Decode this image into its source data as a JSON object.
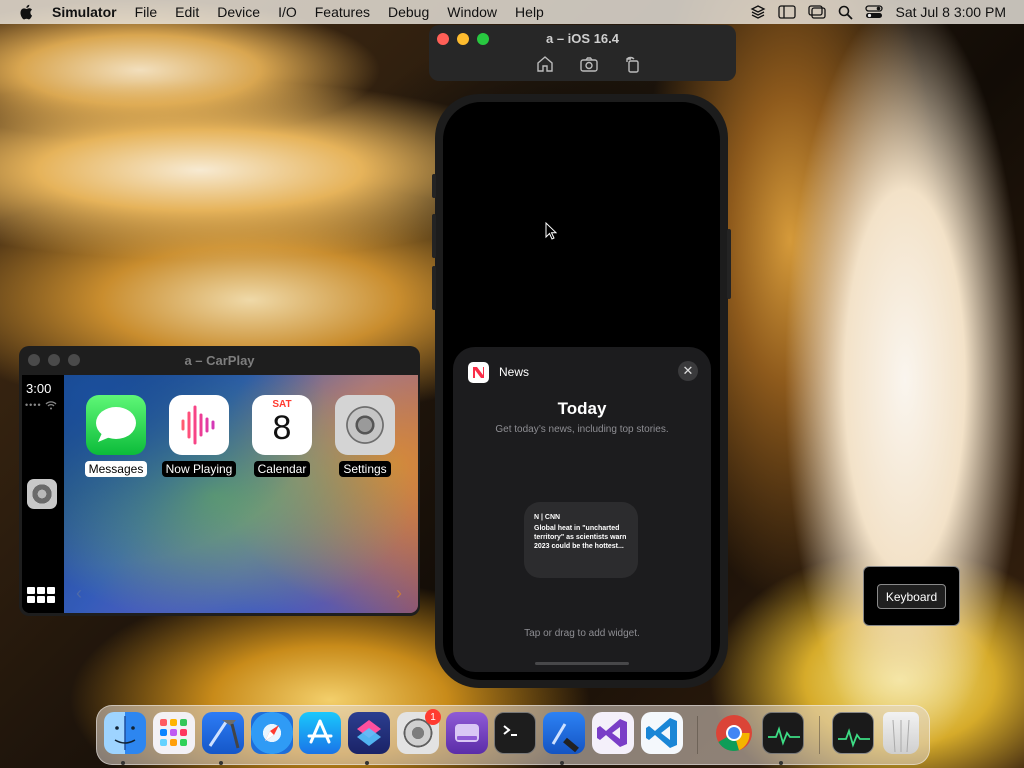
{
  "menubar": {
    "app_name": "Simulator",
    "items": [
      "File",
      "Edit",
      "Device",
      "I/O",
      "Features",
      "Debug",
      "Window",
      "Help"
    ],
    "clock": "Sat Jul 8  3:00 PM"
  },
  "simulator": {
    "title": "a – iOS 16.4"
  },
  "news_sheet": {
    "app_name": "News",
    "close_glyph": "✕",
    "title": "Today",
    "subtitle": "Get today’s news, including top stories.",
    "widget": {
      "source": "N | CNN",
      "headline": "Global heat in \"uncharted territory\" as scientists warn 2023 could be the hottest..."
    },
    "hint": "Tap or drag to add widget."
  },
  "carplay": {
    "title": "a – CarPlay",
    "time": "3:00",
    "apps": [
      {
        "label": "Messages",
        "icon": "messages-icon"
      },
      {
        "label": "Now Playing",
        "icon": "now-playing-icon"
      },
      {
        "label": "Calendar",
        "icon": "calendar-icon"
      },
      {
        "label": "Settings",
        "icon": "settings-icon"
      }
    ],
    "calendar": {
      "day": "SAT",
      "date": "8"
    }
  },
  "keyboard_panel": {
    "label": "Keyboard"
  },
  "dock": {
    "items": [
      "finder-icon",
      "launchpad-icon",
      "xcode-icon",
      "safari-icon",
      "app-store-icon",
      "shortcuts-icon",
      "system-settings-icon",
      "disk-utility-icon",
      "terminal-icon",
      "xcode-dev-icon",
      "visual-studio-icon",
      "vscode-icon",
      "chrome-icon",
      "activity-monitor-icon",
      "activity-monitor-stack-icon",
      "trash-icon"
    ],
    "settings_badge": "1"
  },
  "colors": {
    "close": "#ff5f57",
    "minimize": "#febc2e",
    "zoom": "#28c840",
    "badge": "#ff3b30"
  }
}
